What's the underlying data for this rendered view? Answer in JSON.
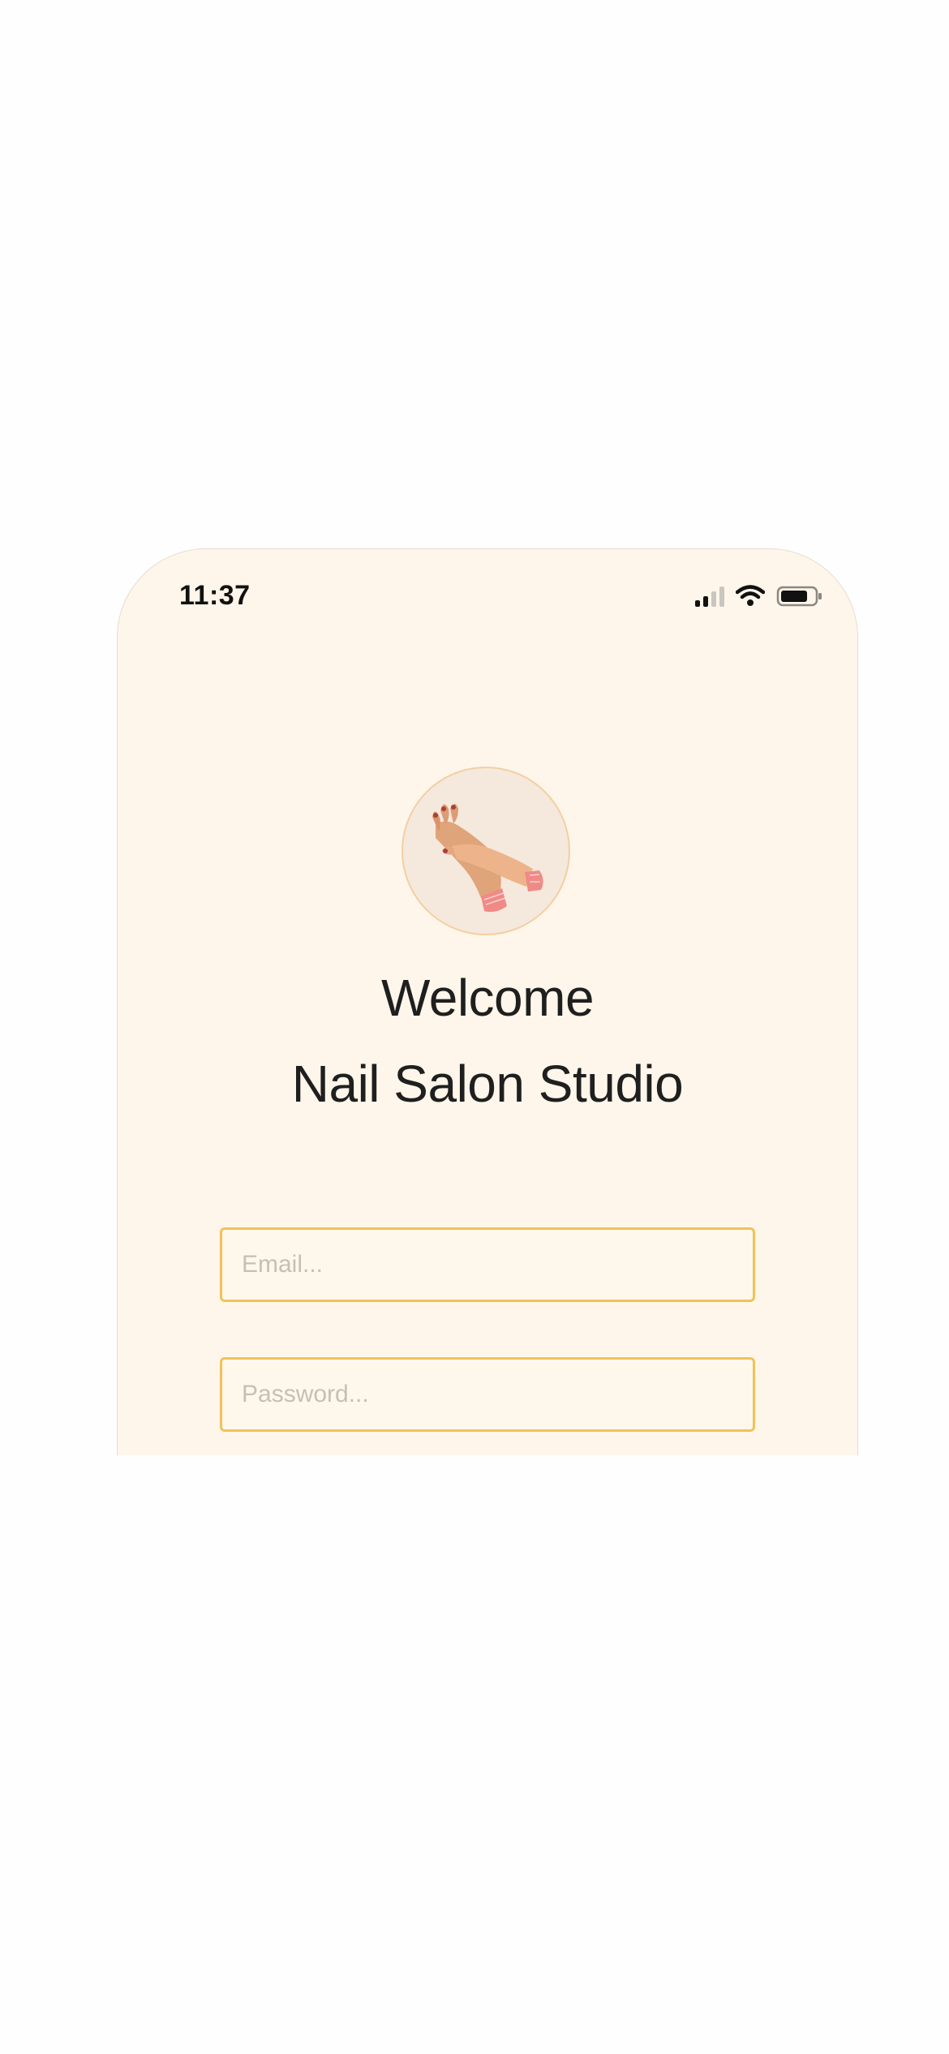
{
  "status_bar": {
    "time": "11:37",
    "icons": [
      "cellular-signal-icon",
      "wifi-icon",
      "battery-icon"
    ]
  },
  "logo": {
    "icon": "hands-manicure-illustration"
  },
  "header": {
    "welcome": "Welcome",
    "studio_name": "Nail Salon Studio"
  },
  "form": {
    "email_placeholder": "Email...",
    "password_placeholder": "Password..."
  },
  "colors": {
    "background": "#fef6ea",
    "field_border": "#f0c25a",
    "text": "#1f1f1f"
  }
}
